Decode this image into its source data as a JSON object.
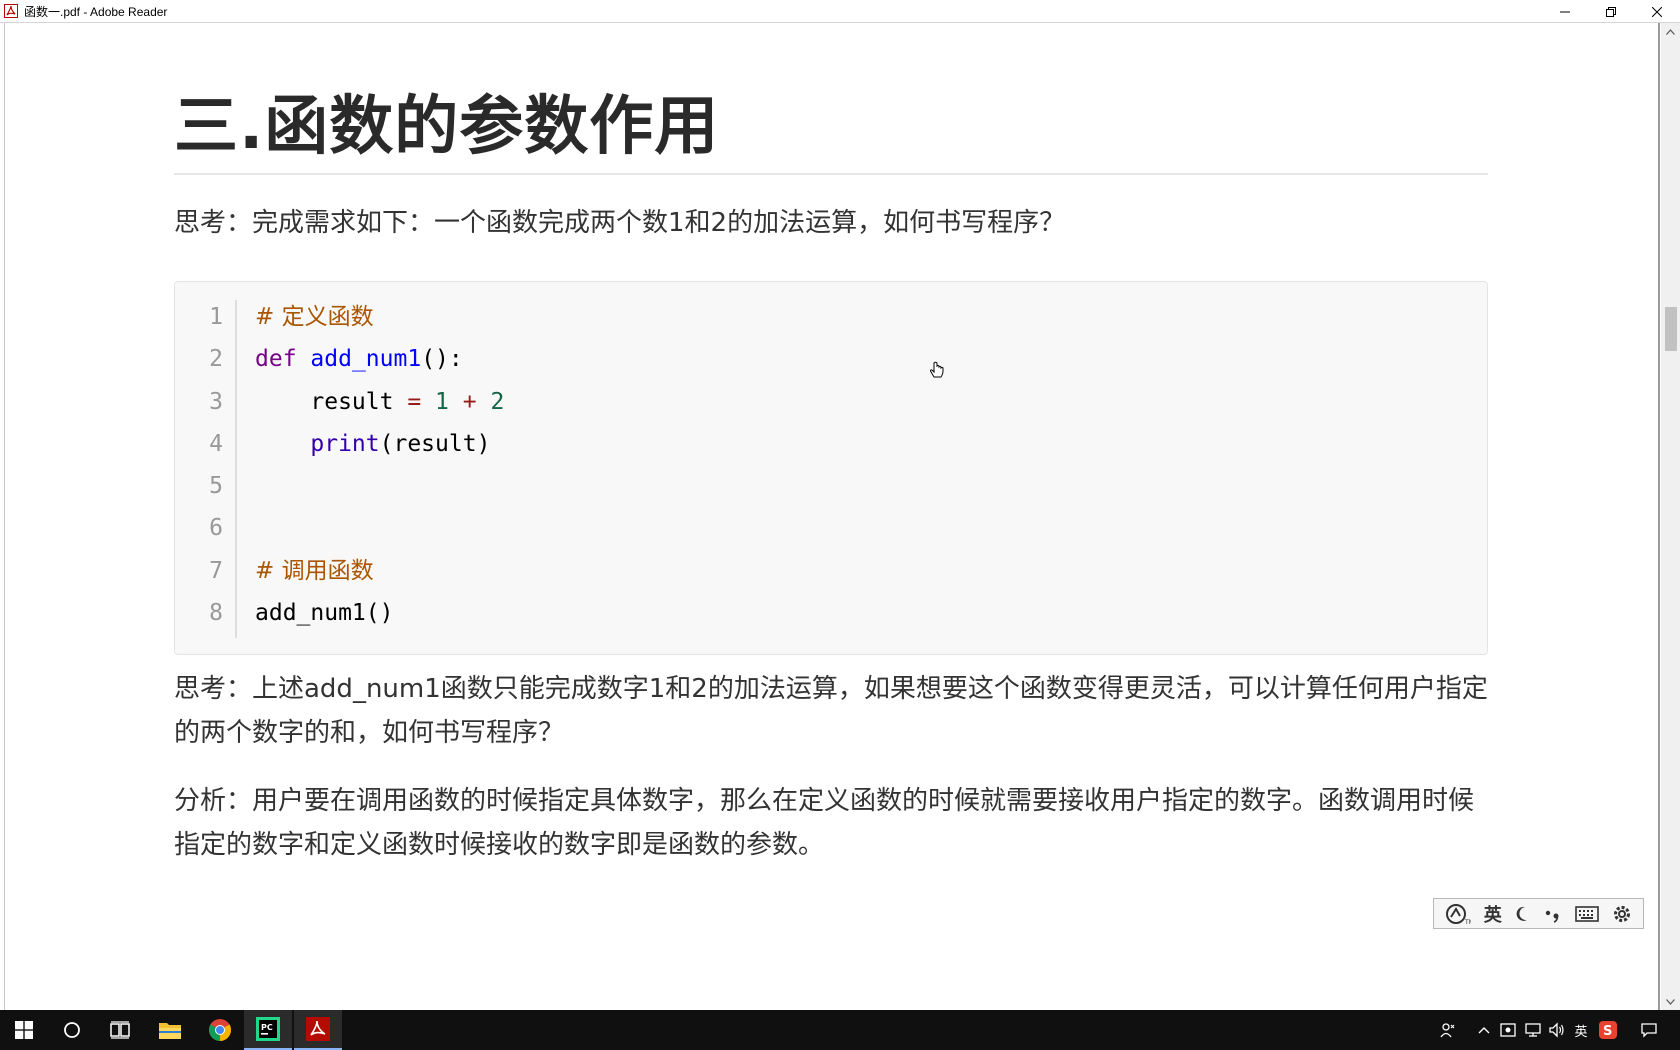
{
  "window": {
    "title": "函数一.pdf - Adobe Reader"
  },
  "document": {
    "heading": "三.函数的参数作用",
    "para1": "思考：完成需求如下：一个函数完成两个数1和2的加法运算，如何书写程序？",
    "code": {
      "line_numbers": [
        "1",
        "2",
        "3",
        "4",
        "5",
        "6",
        "7",
        "8"
      ],
      "lines": [
        {
          "comment": "# 定义函数"
        },
        {
          "kw": "def",
          "fname": "add_num1",
          "rest": "():"
        },
        {
          "indent": "    ",
          "var": "result",
          "eq": " = ",
          "n1": "1",
          "plus": " + ",
          "n2": "2"
        },
        {
          "indent": "    ",
          "builtin": "print",
          "rest": "(result)"
        },
        {},
        {},
        {
          "comment": "# 调用函数"
        },
        {
          "call": "add_num1()"
        }
      ]
    },
    "para2": "思考：上述add_num1函数只能完成数字1和2的加法运算，如果想要这个函数变得更灵活，可以计算任何用户指定的两个数字的和，如何书写程序？",
    "para3": "分析：用户要在调用函数的时候指定具体数字，那么在定义函数的时候就需要接收用户指定的数字。函数调用时候指定的数字和定义函数时候接收的数字即是函数的参数。"
  },
  "ime": {
    "mode_label": "英"
  },
  "taskbar": {
    "tray_lang": "英",
    "icons": [
      "windows-start-icon",
      "search-circle-icon",
      "task-view-icon",
      "file-explorer-icon",
      "chrome-icon",
      "pycharm-icon",
      "adobe-reader-icon"
    ]
  }
}
